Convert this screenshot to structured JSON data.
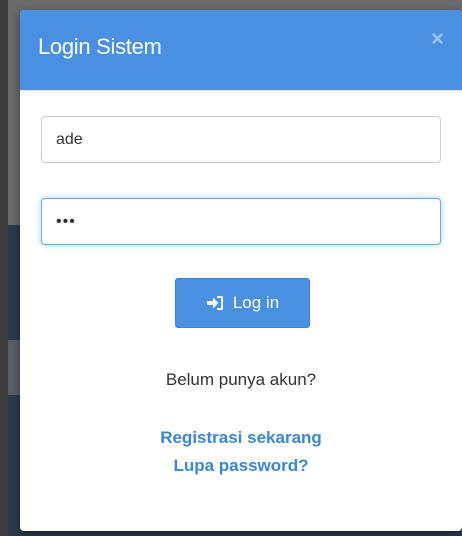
{
  "modal": {
    "title": "Login Sistem",
    "close_label": "×"
  },
  "form": {
    "username_value": "ade",
    "password_value": "•••",
    "login_label": "Log in"
  },
  "footer": {
    "question": "Belum punya akun?",
    "register_link": "Registrasi sekarang",
    "forgot_link": "Lupa password?"
  },
  "colors": {
    "header_bg": "#4a90e2",
    "button_bg": "#4a90e2",
    "link": "#3a86d8",
    "focus_border": "#66afe9"
  },
  "icons": {
    "login": "sign-in-icon",
    "close": "close-icon"
  }
}
